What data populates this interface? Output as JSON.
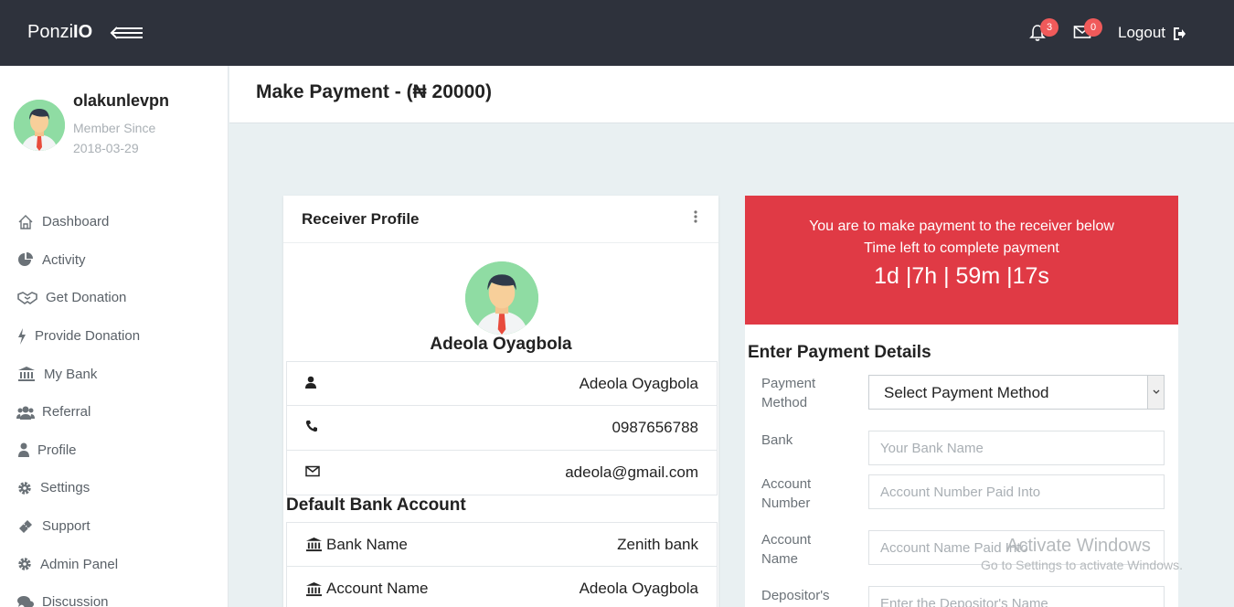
{
  "app": {
    "brand_prefix": "Ponzi",
    "brand_suffix": "IO"
  },
  "topbar": {
    "notifications_count": "3",
    "messages_count": "0",
    "logout_label": "Logout"
  },
  "user": {
    "username": "olakunlevpn",
    "member_since_label": "Member Since",
    "member_since_date": "2018-03-29"
  },
  "sidebar": {
    "items": [
      {
        "label": "Dashboard",
        "icon": "home-icon"
      },
      {
        "label": "Activity",
        "icon": "pie-chart-icon"
      },
      {
        "label": "Get Donation",
        "icon": "handshake-icon"
      },
      {
        "label": "Provide Donation",
        "icon": "bolt-icon"
      },
      {
        "label": "My Bank",
        "icon": "bank-icon"
      },
      {
        "label": "Referral",
        "icon": "users-icon"
      },
      {
        "label": "Profile",
        "icon": "user-icon"
      },
      {
        "label": "Settings",
        "icon": "gear-icon"
      },
      {
        "label": "Support",
        "icon": "ticket-icon"
      },
      {
        "label": "Admin Panel",
        "icon": "gear-icon"
      },
      {
        "label": "Discussion",
        "icon": "comments-icon"
      }
    ]
  },
  "page": {
    "title": "Make Payment - (₦ 20000)"
  },
  "receiver": {
    "card_title": "Receiver Profile",
    "name": "Adeola Oyagbola",
    "full_name": "Adeola Oyagbola",
    "phone": "0987656788",
    "email": "adeola@gmail.com",
    "bank_section_title": "Default Bank Account",
    "bank_name_label": "Bank Name",
    "bank_name_value": "Zenith bank",
    "account_name_label": "Account Name",
    "account_name_value": "Adeola Oyagbola"
  },
  "payment": {
    "alert_line1": "You are to make payment to the receiver below",
    "alert_line2": "Time left to complete payment",
    "timer": "1d |7h | 59m |17s",
    "section_title": "Enter Payment Details",
    "method_label": "Payment Method",
    "method_value": "Select Payment Method",
    "bank_label": "Bank",
    "bank_placeholder": "Your Bank Name",
    "account_number_label": "Account Number",
    "account_number_placeholder": "Account Number Paid Into",
    "account_name_label": "Account Name",
    "account_name_placeholder": "Account Name Paid Into",
    "depositor_label": "Depositor's",
    "depositor_placeholder": "Enter the Depositor's Name"
  },
  "watermark": {
    "line1": "Activate Windows",
    "line2": "Go to Settings to activate Windows."
  },
  "colors": {
    "topbar": "#2e323c",
    "alert": "#e03a45",
    "badge": "#f05a5a",
    "avatar_bg": "#8fdca3"
  }
}
